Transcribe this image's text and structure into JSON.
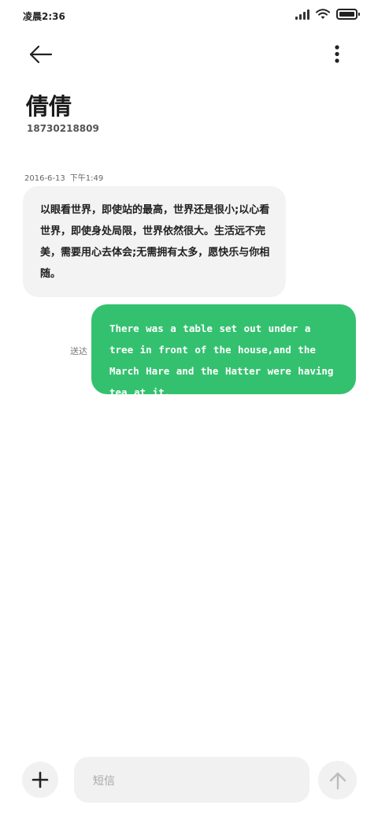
{
  "status_bar": {
    "time": "凌晨2:36",
    "icons": [
      "signal-icon",
      "wifi-icon",
      "battery-icon"
    ]
  },
  "header": {
    "back_icon": "arrow-left-icon",
    "more_icon": "more-vertical-icon"
  },
  "contact": {
    "name": "倩倩",
    "number": "18730218809"
  },
  "conversation": {
    "timestamp_date": "2016-6-13",
    "timestamp_time": "下午1:49",
    "received": {
      "text": "以眼看世界，即使站的最高，世界还是很小;以心看世界，即使身处局限，世界依然很大。生活远不完美，需要用心去体会;无需拥有太多，愿快乐与你相随。"
    },
    "sent": {
      "status": "送达",
      "text": "There was a table set out under a tree in front of the house,and the March Hare and the Hatter were having tea at it."
    }
  },
  "composer": {
    "add_icon": "plus-icon",
    "placeholder": "短信",
    "send_icon": "arrow-up-icon"
  },
  "colors": {
    "sent_bubble": "#34c16f",
    "received_bubble": "#f3f3f3",
    "composer_bg": "#f1f1f1"
  }
}
